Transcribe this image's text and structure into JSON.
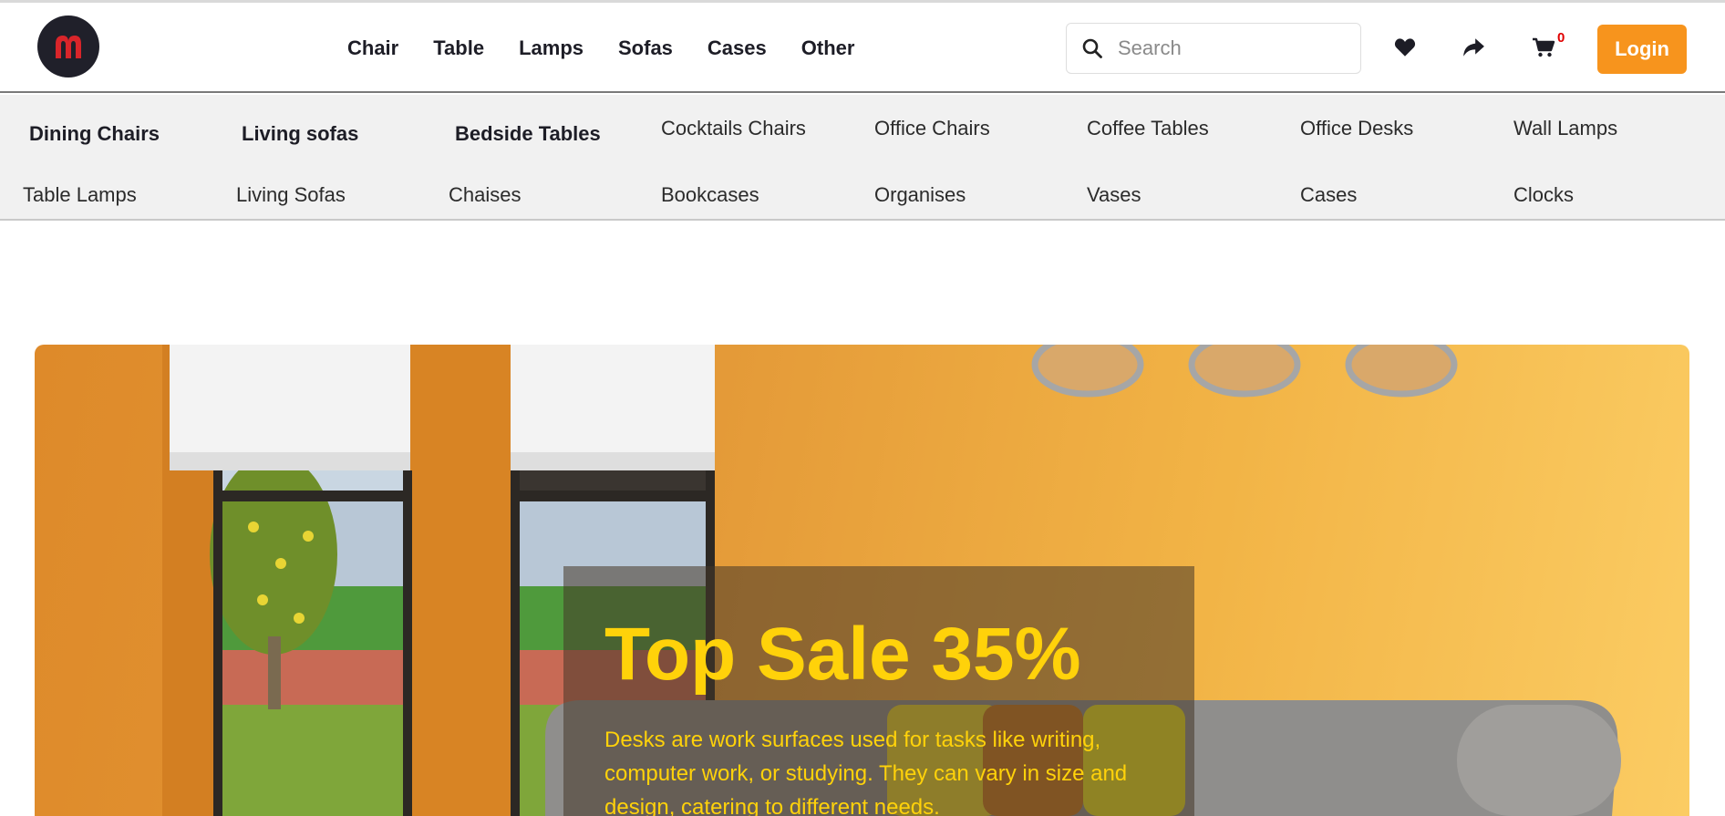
{
  "brand": {
    "logo_letter": "m",
    "logo_color": "#d9252a"
  },
  "nav": {
    "items": [
      "Chair",
      "Table",
      "Lamps",
      "Sofas",
      "Cases",
      "Other"
    ]
  },
  "search": {
    "placeholder": "Search",
    "value": ""
  },
  "actions": {
    "wishlist_icon": "heart-icon",
    "share_icon": "share-icon",
    "cart_icon": "cart-icon",
    "cart_count": "0",
    "login_label": "Login"
  },
  "submenu": {
    "row1": [
      "Dining Chairs",
      "Living sofas",
      "Bedside Tables",
      "Cocktails Chairs",
      "Office Chairs",
      "Coffee Tables",
      "Office Desks",
      "Wall Lamps"
    ],
    "row2": [
      "Table Lamps",
      "Living Sofas",
      "Chaises",
      "Bookcases",
      "Organises",
      "Vases",
      "Cases",
      "Clocks"
    ]
  },
  "hero": {
    "title": "Top Sale 35%",
    "description": "Desks are work surfaces used for tasks like writing, computer work, or studying. They can vary in size and design, catering to different needs."
  },
  "colors": {
    "accent": "#f7941d",
    "promo_text": "#ffd20a",
    "cart_badge": "#e00000",
    "dark": "#1d1d26"
  }
}
